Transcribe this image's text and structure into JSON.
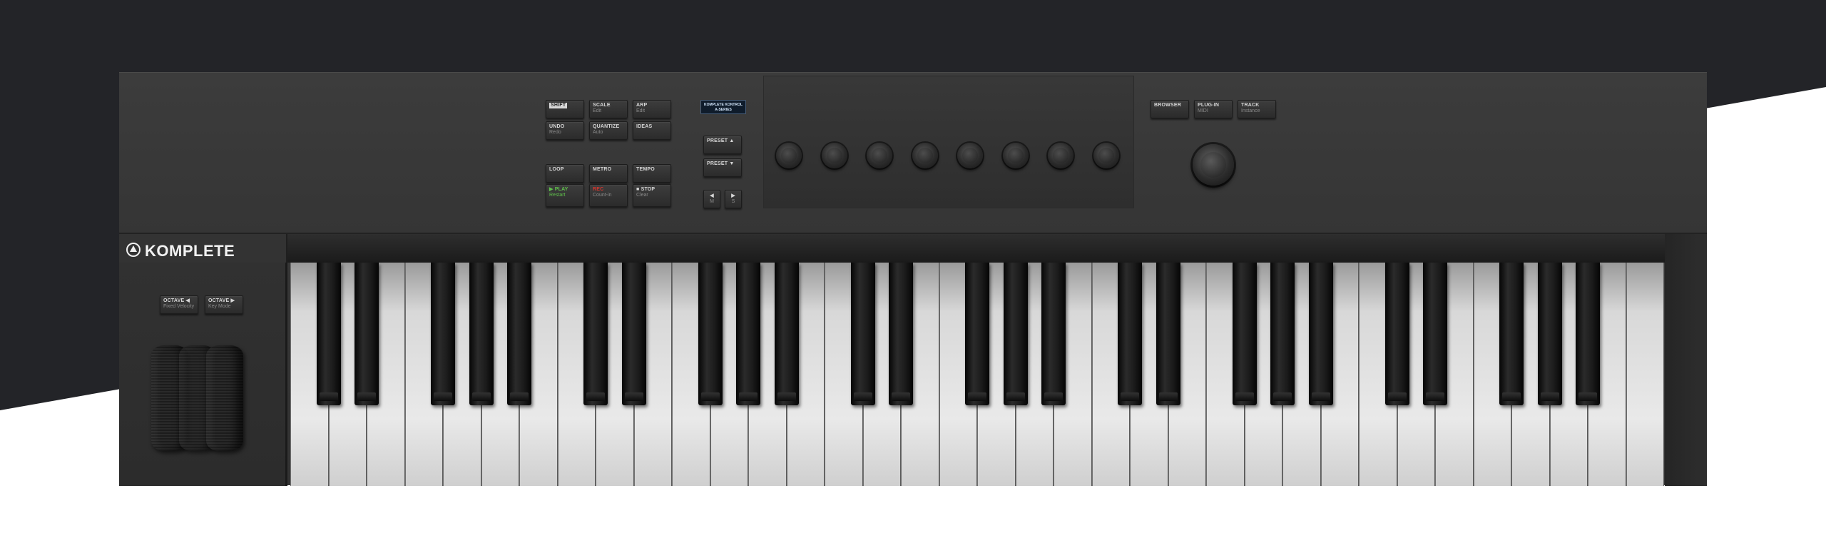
{
  "brand": {
    "name": "KOMPLETE"
  },
  "display": {
    "line1": "KOMPLETE KONTROL",
    "line2": "A-SERIES"
  },
  "buttons": {
    "shift": {
      "label": "SHIFT"
    },
    "scale": {
      "label": "SCALE",
      "sub": "Edit"
    },
    "arp": {
      "label": "ARP",
      "sub": "Edit"
    },
    "undo": {
      "label": "UNDO",
      "sub": "Redo"
    },
    "quantize": {
      "label": "QUANTIZE",
      "sub": "Auto"
    },
    "ideas": {
      "label": "IDEAS"
    },
    "loop": {
      "label": "LOOP"
    },
    "metro": {
      "label": "METRO"
    },
    "tempo": {
      "label": "TEMPO"
    },
    "play": {
      "label": "▶ PLAY",
      "sub": "Restart"
    },
    "rec": {
      "label": "REC",
      "sub": "Count-in"
    },
    "stop": {
      "label": "■ STOP",
      "sub": "Clear"
    },
    "preset_up": {
      "label": "PRESET ▲"
    },
    "preset_down": {
      "label": "PRESET ▼"
    },
    "nav_left": {
      "label": "◀",
      "sub": "M"
    },
    "nav_right": {
      "label": "▶",
      "sub": "S"
    },
    "browser": {
      "label": "BROWSER"
    },
    "plugin": {
      "label": "PLUG-IN",
      "sub": "MIDI"
    },
    "track": {
      "label": "TRACK",
      "sub": "Instance"
    },
    "octave_down": {
      "label": "OCTAVE ◀",
      "sub": "Fixed Velocity"
    },
    "octave_up": {
      "label": "OCTAVE ▶",
      "sub": "Key Mode"
    }
  },
  "keyboard": {
    "white_keys": 36,
    "black_keys": 25,
    "knobs": 8
  },
  "colors": {
    "play": "#5fbf4b",
    "rec": "#d3362e",
    "display_bg": "#0f1c2b"
  },
  "icons": {
    "logo": "native-instruments-logo-icon"
  }
}
